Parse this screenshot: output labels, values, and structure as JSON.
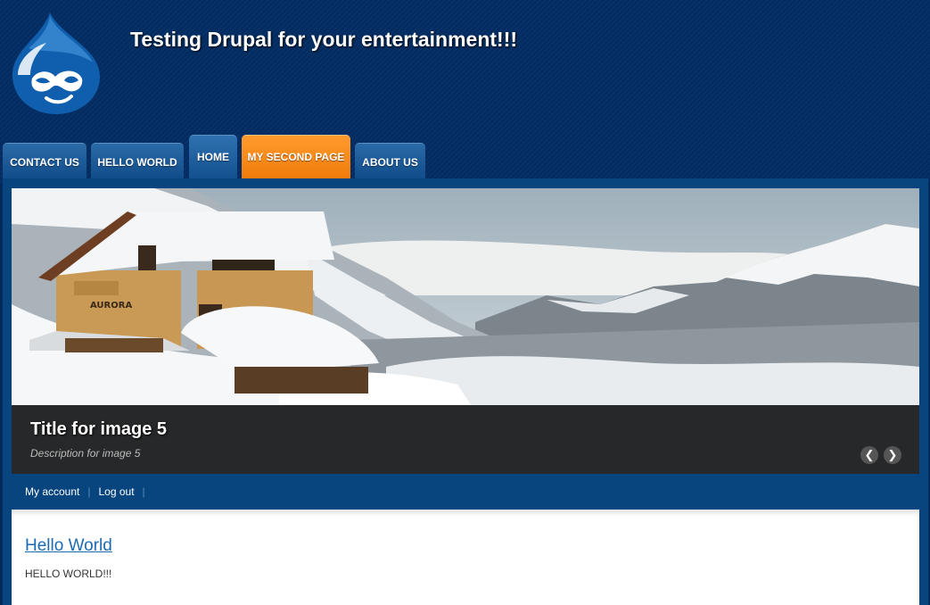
{
  "site": {
    "title": "Testing Drupal for your entertainment!!!",
    "logo_icon": "drupal-drop-logo"
  },
  "nav": {
    "tabs": [
      {
        "label": "CONTACT US",
        "state": "normal"
      },
      {
        "label": "HELLO WORLD",
        "state": "normal"
      },
      {
        "label": "HOME",
        "state": "active"
      },
      {
        "label": "MY SECOND PAGE",
        "state": "highlight"
      },
      {
        "label": "ABOUT US",
        "state": "normal"
      }
    ]
  },
  "slideshow": {
    "title": "Title for image 5",
    "description": "Description for image 5",
    "house_sign": "AURORA",
    "prev_icon": "chevron-left-icon",
    "next_icon": "chevron-right-icon",
    "prev_glyph": "❮",
    "next_glyph": "❯"
  },
  "secondary_menu": {
    "my_account": "My account",
    "logout": "Log out",
    "separator": "|"
  },
  "node": {
    "title": "Hello World",
    "body": "HELLO WORLD!!!"
  },
  "colors": {
    "header_bg": "#032d62",
    "tab_blue": "#1c5c9b",
    "tab_orange": "#f58a10",
    "content_band": "#08457f",
    "link": "#1c6bb3"
  }
}
